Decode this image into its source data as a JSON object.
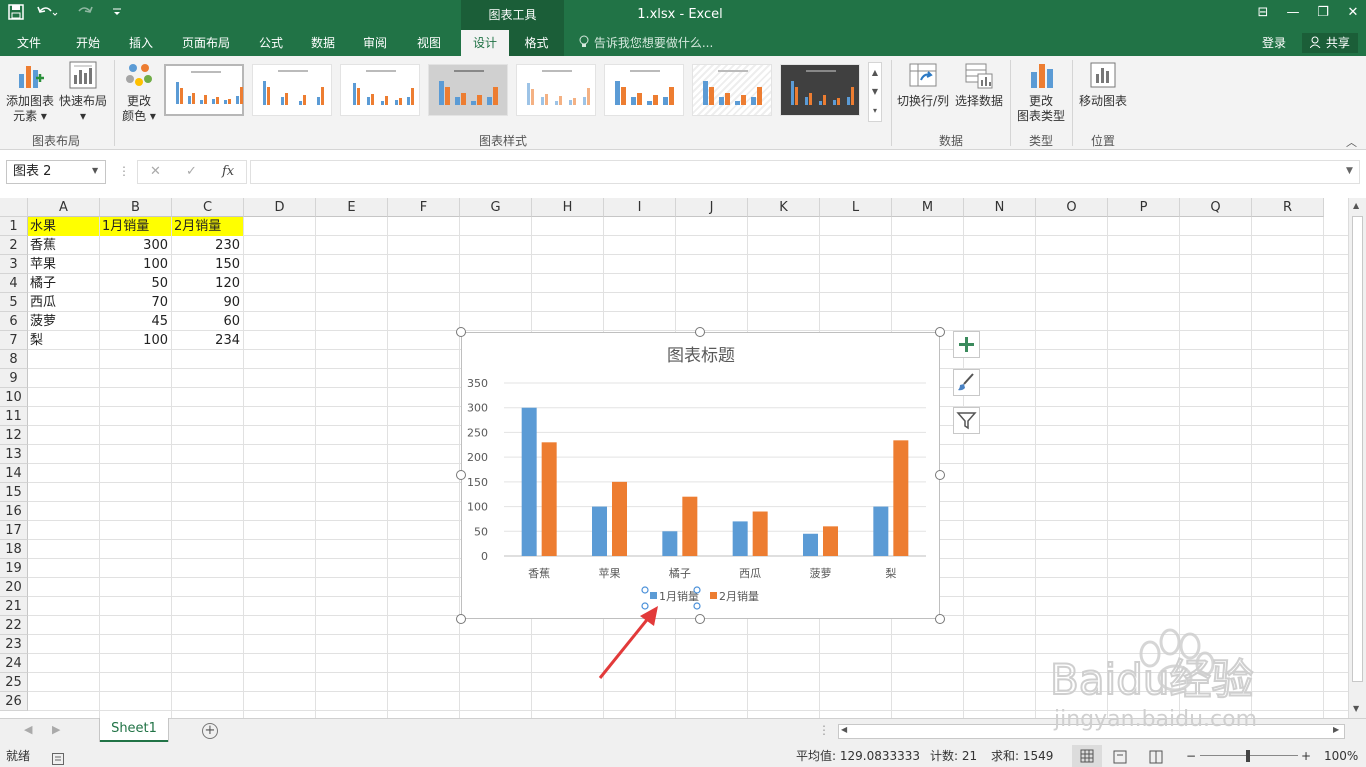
{
  "titlebar": {
    "context_tab": "图表工具",
    "window_title": "1.xlsx - Excel",
    "minimize_glyph": "—",
    "restore_glyph": "❐",
    "close_glyph": "✕",
    "ribbon_display_glyph": "⊟"
  },
  "tabs": [
    "文件",
    "开始",
    "插入",
    "页面布局",
    "公式",
    "数据",
    "审阅",
    "视图",
    "设计",
    "格式"
  ],
  "active_tab": "设计",
  "tellme": "告诉我您想要做什么...",
  "login": "登录",
  "share": "共享",
  "ribbon": {
    "add_chart_element_1": "添加图表",
    "add_chart_element_2": "元素 ▾",
    "quick_layout_1": "快速布局",
    "quick_layout_2": "▾",
    "change_colors_1": "更改",
    "change_colors_2": "颜色 ▾",
    "switch_row_col": "切换行/列",
    "select_data": "选择数据",
    "change_type_1": "更改",
    "change_type_2": "图表类型",
    "move_chart": "移动图表",
    "group_layout": "图表布局",
    "group_styles": "图表样式",
    "group_data": "数据",
    "group_type": "类型",
    "group_location": "位置"
  },
  "formula": {
    "namebox": "图表 2",
    "cancel": "✕",
    "enter": "✓",
    "fx": "fx",
    "value": ""
  },
  "columns": [
    "A",
    "B",
    "C",
    "D",
    "E",
    "F",
    "G",
    "H",
    "I",
    "J",
    "K",
    "L",
    "M",
    "N",
    "O",
    "P",
    "Q",
    "R"
  ],
  "rows": [
    "1",
    "2",
    "3",
    "4",
    "5",
    "6",
    "7",
    "8",
    "9",
    "10",
    "11",
    "12",
    "13",
    "14",
    "15",
    "16",
    "17",
    "18",
    "19",
    "20",
    "21",
    "22",
    "23",
    "24",
    "25",
    "26"
  ],
  "sheet": {
    "header": [
      "水果",
      "1月销量",
      "2月销量"
    ],
    "rows": [
      [
        "香蕉",
        "300",
        "230"
      ],
      [
        "苹果",
        "100",
        "150"
      ],
      [
        "橘子",
        "50",
        "120"
      ],
      [
        "西瓜",
        "70",
        "90"
      ],
      [
        "菠萝",
        "45",
        "60"
      ],
      [
        "梨",
        "100",
        "234"
      ]
    ]
  },
  "chart_data": {
    "type": "bar",
    "title": "图表标题",
    "categories": [
      "香蕉",
      "苹果",
      "橘子",
      "西瓜",
      "菠萝",
      "梨"
    ],
    "series": [
      {
        "name": "1月销量",
        "values": [
          300,
          100,
          50,
          70,
          45,
          100
        ],
        "color": "#5b9bd5"
      },
      {
        "name": "2月销量",
        "values": [
          230,
          150,
          120,
          90,
          60,
          234
        ],
        "color": "#ed7d31"
      }
    ],
    "yticks": [
      "0",
      "50",
      "100",
      "150",
      "200",
      "250",
      "300",
      "350"
    ],
    "ylim": [
      0,
      350
    ],
    "grid": true,
    "legend": "bottom"
  },
  "chart_side": {
    "elements_glyph": "+",
    "styles_glyph": "✎",
    "filter_glyph": "▼"
  },
  "sheettabs": {
    "name": "Sheet1",
    "add": "+"
  },
  "status": {
    "ready": "就绪",
    "average": "平均值: 129.0833333",
    "count": "计数: 21",
    "sum": "求和: 1549",
    "zoom": "100%"
  },
  "watermark": {
    "brand": "Baidu经验",
    "url": "jingyan.baidu.com"
  }
}
